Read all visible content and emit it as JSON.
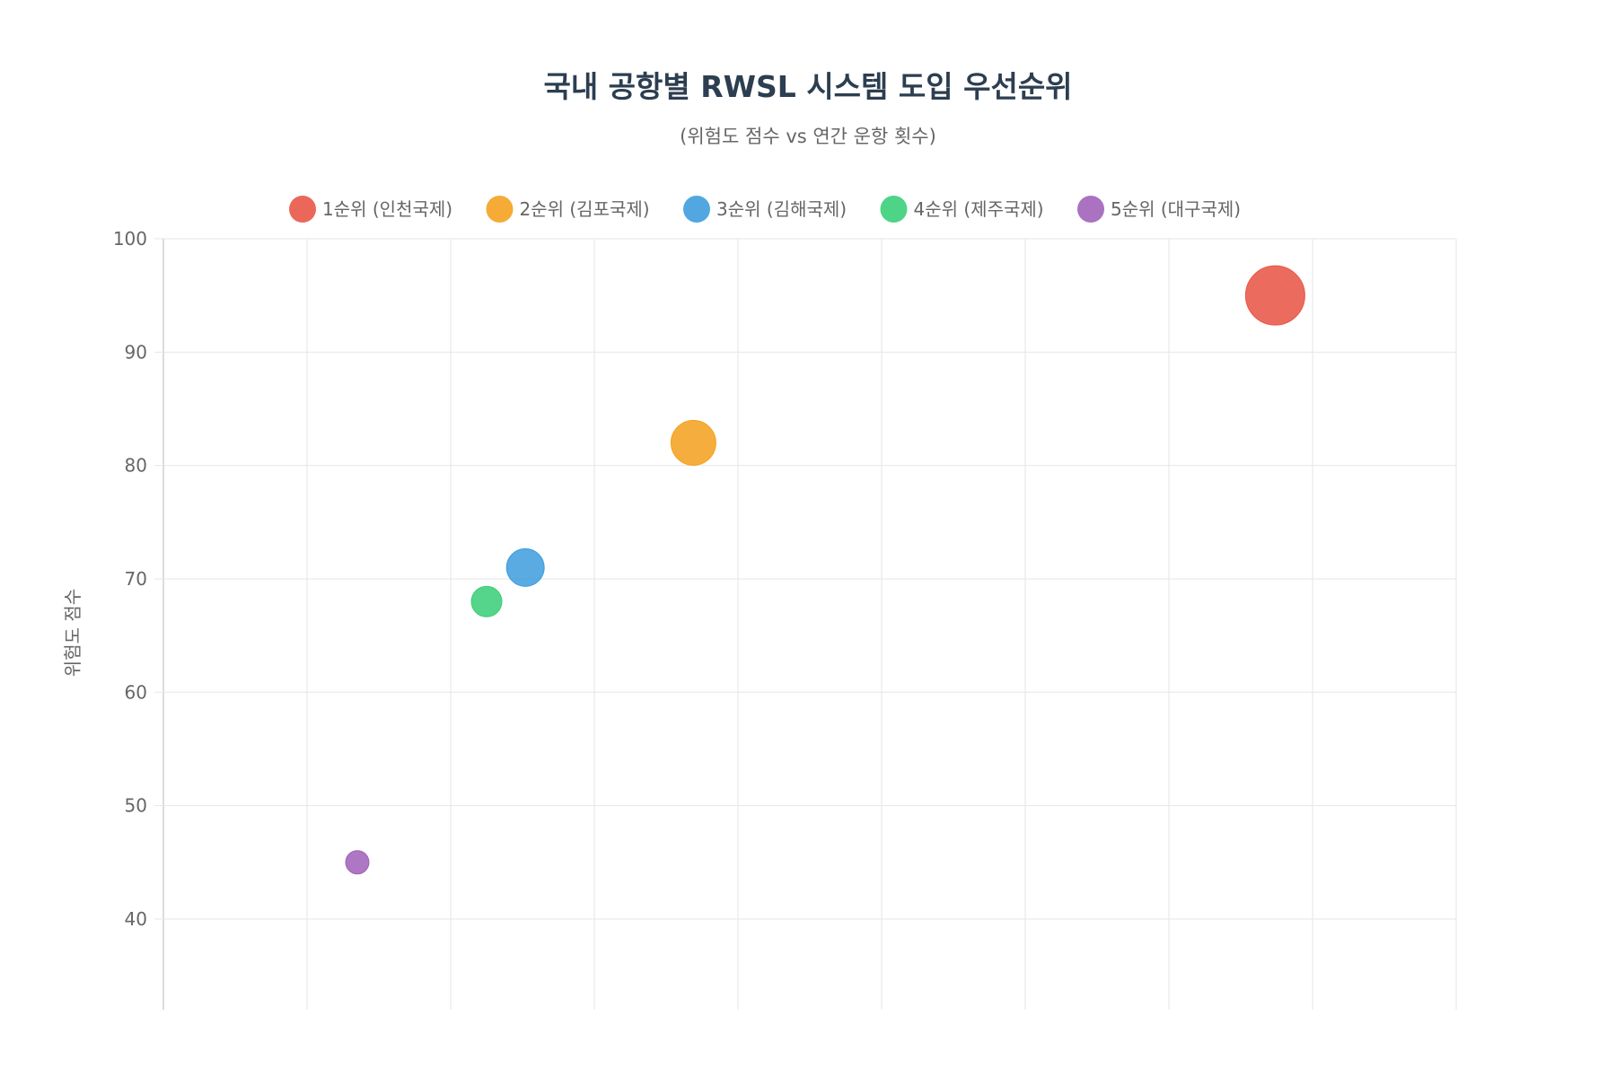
{
  "chart_data": {
    "type": "bubble",
    "title": "국내 공항별 RWSL 시스템 도입 우선순위",
    "subtitle": "(위험도 점수 vs 연간 운항 횟수)",
    "ylabel": "위험도 점수",
    "xlabel": "",
    "ylim": [
      32,
      100
    ],
    "yticks": [
      40,
      50,
      60,
      70,
      80,
      90,
      100
    ],
    "grid": true,
    "legend_position": "top",
    "series": [
      {
        "name": "1순위 (인천국제)",
        "color": "#e74c3c",
        "x": 0.86,
        "y": 95,
        "r": 3.0
      },
      {
        "name": "2순위 (김포국제)",
        "color": "#f39c12",
        "x": 0.41,
        "y": 82,
        "r": 2.2
      },
      {
        "name": "3순위 (김해국제)",
        "color": "#3498db",
        "x": 0.28,
        "y": 71,
        "r": 1.8
      },
      {
        "name": "4순위 (제주국제)",
        "color": "#2ecc71",
        "x": 0.25,
        "y": 68,
        "r": 1.4
      },
      {
        "name": "5순위 (대구국제)",
        "color": "#9b59b6",
        "x": 0.15,
        "y": 45,
        "r": 1.0
      }
    ]
  }
}
